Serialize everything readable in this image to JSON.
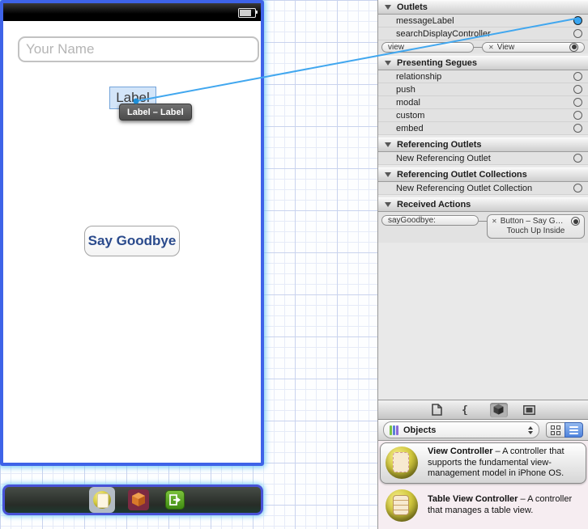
{
  "canvas": {
    "text_field": {
      "placeholder": "Your Name"
    },
    "label": {
      "text": "Label"
    },
    "drag_tooltip": "Label – Label",
    "button": {
      "label": "Say Goodbye"
    }
  },
  "inspector": {
    "sections": [
      {
        "title": "Outlets",
        "rows": [
          {
            "label": "messageLabel"
          },
          {
            "label": "searchDisplayController"
          },
          {
            "source": "view",
            "target": "View"
          }
        ]
      },
      {
        "title": "Presenting Segues",
        "rows": [
          {
            "label": "relationship"
          },
          {
            "label": "push"
          },
          {
            "label": "modal"
          },
          {
            "label": "custom"
          },
          {
            "label": "embed"
          }
        ]
      },
      {
        "title": "Referencing Outlets",
        "rows": [
          {
            "label": "New Referencing Outlet"
          }
        ]
      },
      {
        "title": "Referencing Outlet Collections",
        "rows": [
          {
            "label": "New Referencing Outlet Collection"
          }
        ]
      },
      {
        "title": "Received Actions",
        "rows": [
          {
            "source": "sayGoodbye:",
            "target": "Button – Say G…",
            "event": "Touch Up Inside"
          }
        ]
      }
    ]
  },
  "library": {
    "dropdown": {
      "label": "Objects"
    },
    "items": [
      {
        "title": "View Controller",
        "description": "– A controller that supports the fundamental view-management model in iPhone OS."
      },
      {
        "title": "Table View Controller",
        "description": "– A controller that manages a table view."
      }
    ]
  },
  "icons": {
    "disconnect": "✕"
  },
  "colors": {
    "selection_blue": "#3e63e8",
    "connection_line": "#41a7ef",
    "highlight_circle": "#38a6f2",
    "book_green": "#7ac243",
    "book_blue": "#5a7fd6",
    "book_purple": "#8a6ad6"
  }
}
